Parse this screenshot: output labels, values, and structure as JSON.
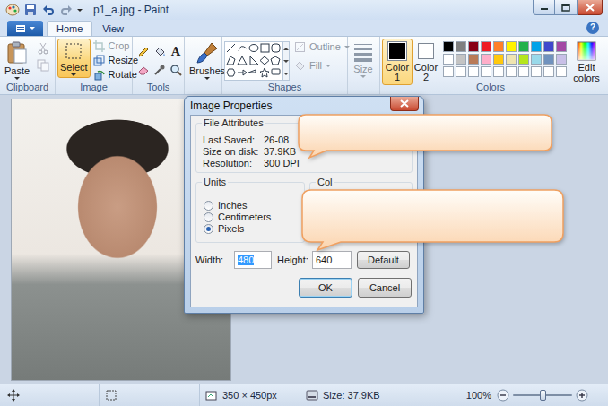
{
  "window": {
    "title": "p1_a.jpg - Paint"
  },
  "ribbon_tabs": [
    {
      "label": "Home",
      "selected": true
    },
    {
      "label": "View",
      "selected": false
    }
  ],
  "help": "?",
  "clipboard": {
    "label": "Clipboard",
    "paste": "Paste",
    "small_tools": [
      {
        "kind": "cut",
        "disabled": true
      },
      {
        "kind": "copy",
        "disabled": true
      }
    ]
  },
  "image": {
    "label": "Image",
    "select": {
      "label": "Select",
      "selected": true
    },
    "items": [
      {
        "kind": "crop",
        "label": "Crop",
        "disabled": true
      },
      {
        "kind": "resize",
        "label": "Resize",
        "disabled": false
      },
      {
        "kind": "rotate",
        "label": "Rotate",
        "disabled": false
      }
    ]
  },
  "tools": {
    "label": "Tools",
    "items": [
      {
        "kind": "pencil",
        "glyph": ""
      },
      {
        "kind": "fill",
        "glyph": ""
      },
      {
        "kind": "text",
        "glyph": "A"
      },
      {
        "kind": "eraser",
        "glyph": ""
      },
      {
        "kind": "picker",
        "glyph": ""
      },
      {
        "kind": "magnifier",
        "glyph": ""
      }
    ]
  },
  "brushes": {
    "label": "Brushes"
  },
  "shapes": {
    "label": "Shapes",
    "options": [
      {
        "kind": "outline",
        "label": "Outline",
        "disabled": true
      },
      {
        "kind": "fill",
        "label": "Fill",
        "disabled": true
      }
    ]
  },
  "size": {
    "label": "Size",
    "disabled": true
  },
  "colors": {
    "label": "Colors",
    "slots": [
      {
        "label": "Color 1",
        "color": "#000000",
        "selected": true
      },
      {
        "label": "Color 2",
        "color": "#ffffff",
        "selected": false
      }
    ],
    "palette": [
      {
        "color": "#000000"
      },
      {
        "color": "#7f7f7f"
      },
      {
        "color": "#880015"
      },
      {
        "color": "#ed1c24"
      },
      {
        "color": "#ff7f27"
      },
      {
        "color": "#fff200"
      },
      {
        "color": "#22b14c"
      },
      {
        "color": "#00a2e8"
      },
      {
        "color": "#3f48cc"
      },
      {
        "color": "#a349a4"
      },
      {
        "color": "#ffffff"
      },
      {
        "color": "#c3c3c3"
      },
      {
        "color": "#b97a57"
      },
      {
        "color": "#ffaec9"
      },
      {
        "color": "#ffc90e"
      },
      {
        "color": "#efe4b0"
      },
      {
        "color": "#b5e61d"
      },
      {
        "color": "#99d9ea"
      },
      {
        "color": "#7092be"
      },
      {
        "color": "#c8bfe7"
      },
      {
        "color": "#ffffff"
      },
      {
        "color": "#ffffff"
      },
      {
        "color": "#ffffff"
      },
      {
        "color": "#ffffff"
      },
      {
        "color": "#ffffff"
      },
      {
        "color": "#ffffff"
      },
      {
        "color": "#ffffff"
      },
      {
        "color": "#ffffff"
      },
      {
        "color": "#ffffff"
      },
      {
        "color": "#ffffff"
      }
    ],
    "edit": "Edit colors"
  },
  "dialog": {
    "title": "Image Properties",
    "file_attributes": {
      "label": "File Attributes",
      "rows": [
        {
          "label": "Last Saved:",
          "value": "26-08"
        },
        {
          "label": "Size on disk:",
          "value": "37.9KB"
        },
        {
          "label": "Resolution:",
          "value": "300 DPI"
        }
      ]
    },
    "units": {
      "label": "Units",
      "options": [
        {
          "label": "Inches",
          "selected": false
        },
        {
          "label": "Centimeters",
          "selected": false
        },
        {
          "label": "Pixels",
          "selected": true
        }
      ]
    },
    "colors_group": {
      "label": "Col"
    },
    "width": {
      "label": "Width:",
      "value": "480",
      "selected": true
    },
    "height": {
      "label": "Height:",
      "value": "640",
      "selected": false
    },
    "default_button": "Default",
    "buttons": [
      {
        "label": "OK",
        "default": true
      },
      {
        "label": "Cancel",
        "default": false
      }
    ]
  },
  "status_bar": {
    "dimensions": "350 × 450px",
    "size": "Size: 37.9KB",
    "zoom": {
      "reading": "100%",
      "level": 0.5
    }
  }
}
